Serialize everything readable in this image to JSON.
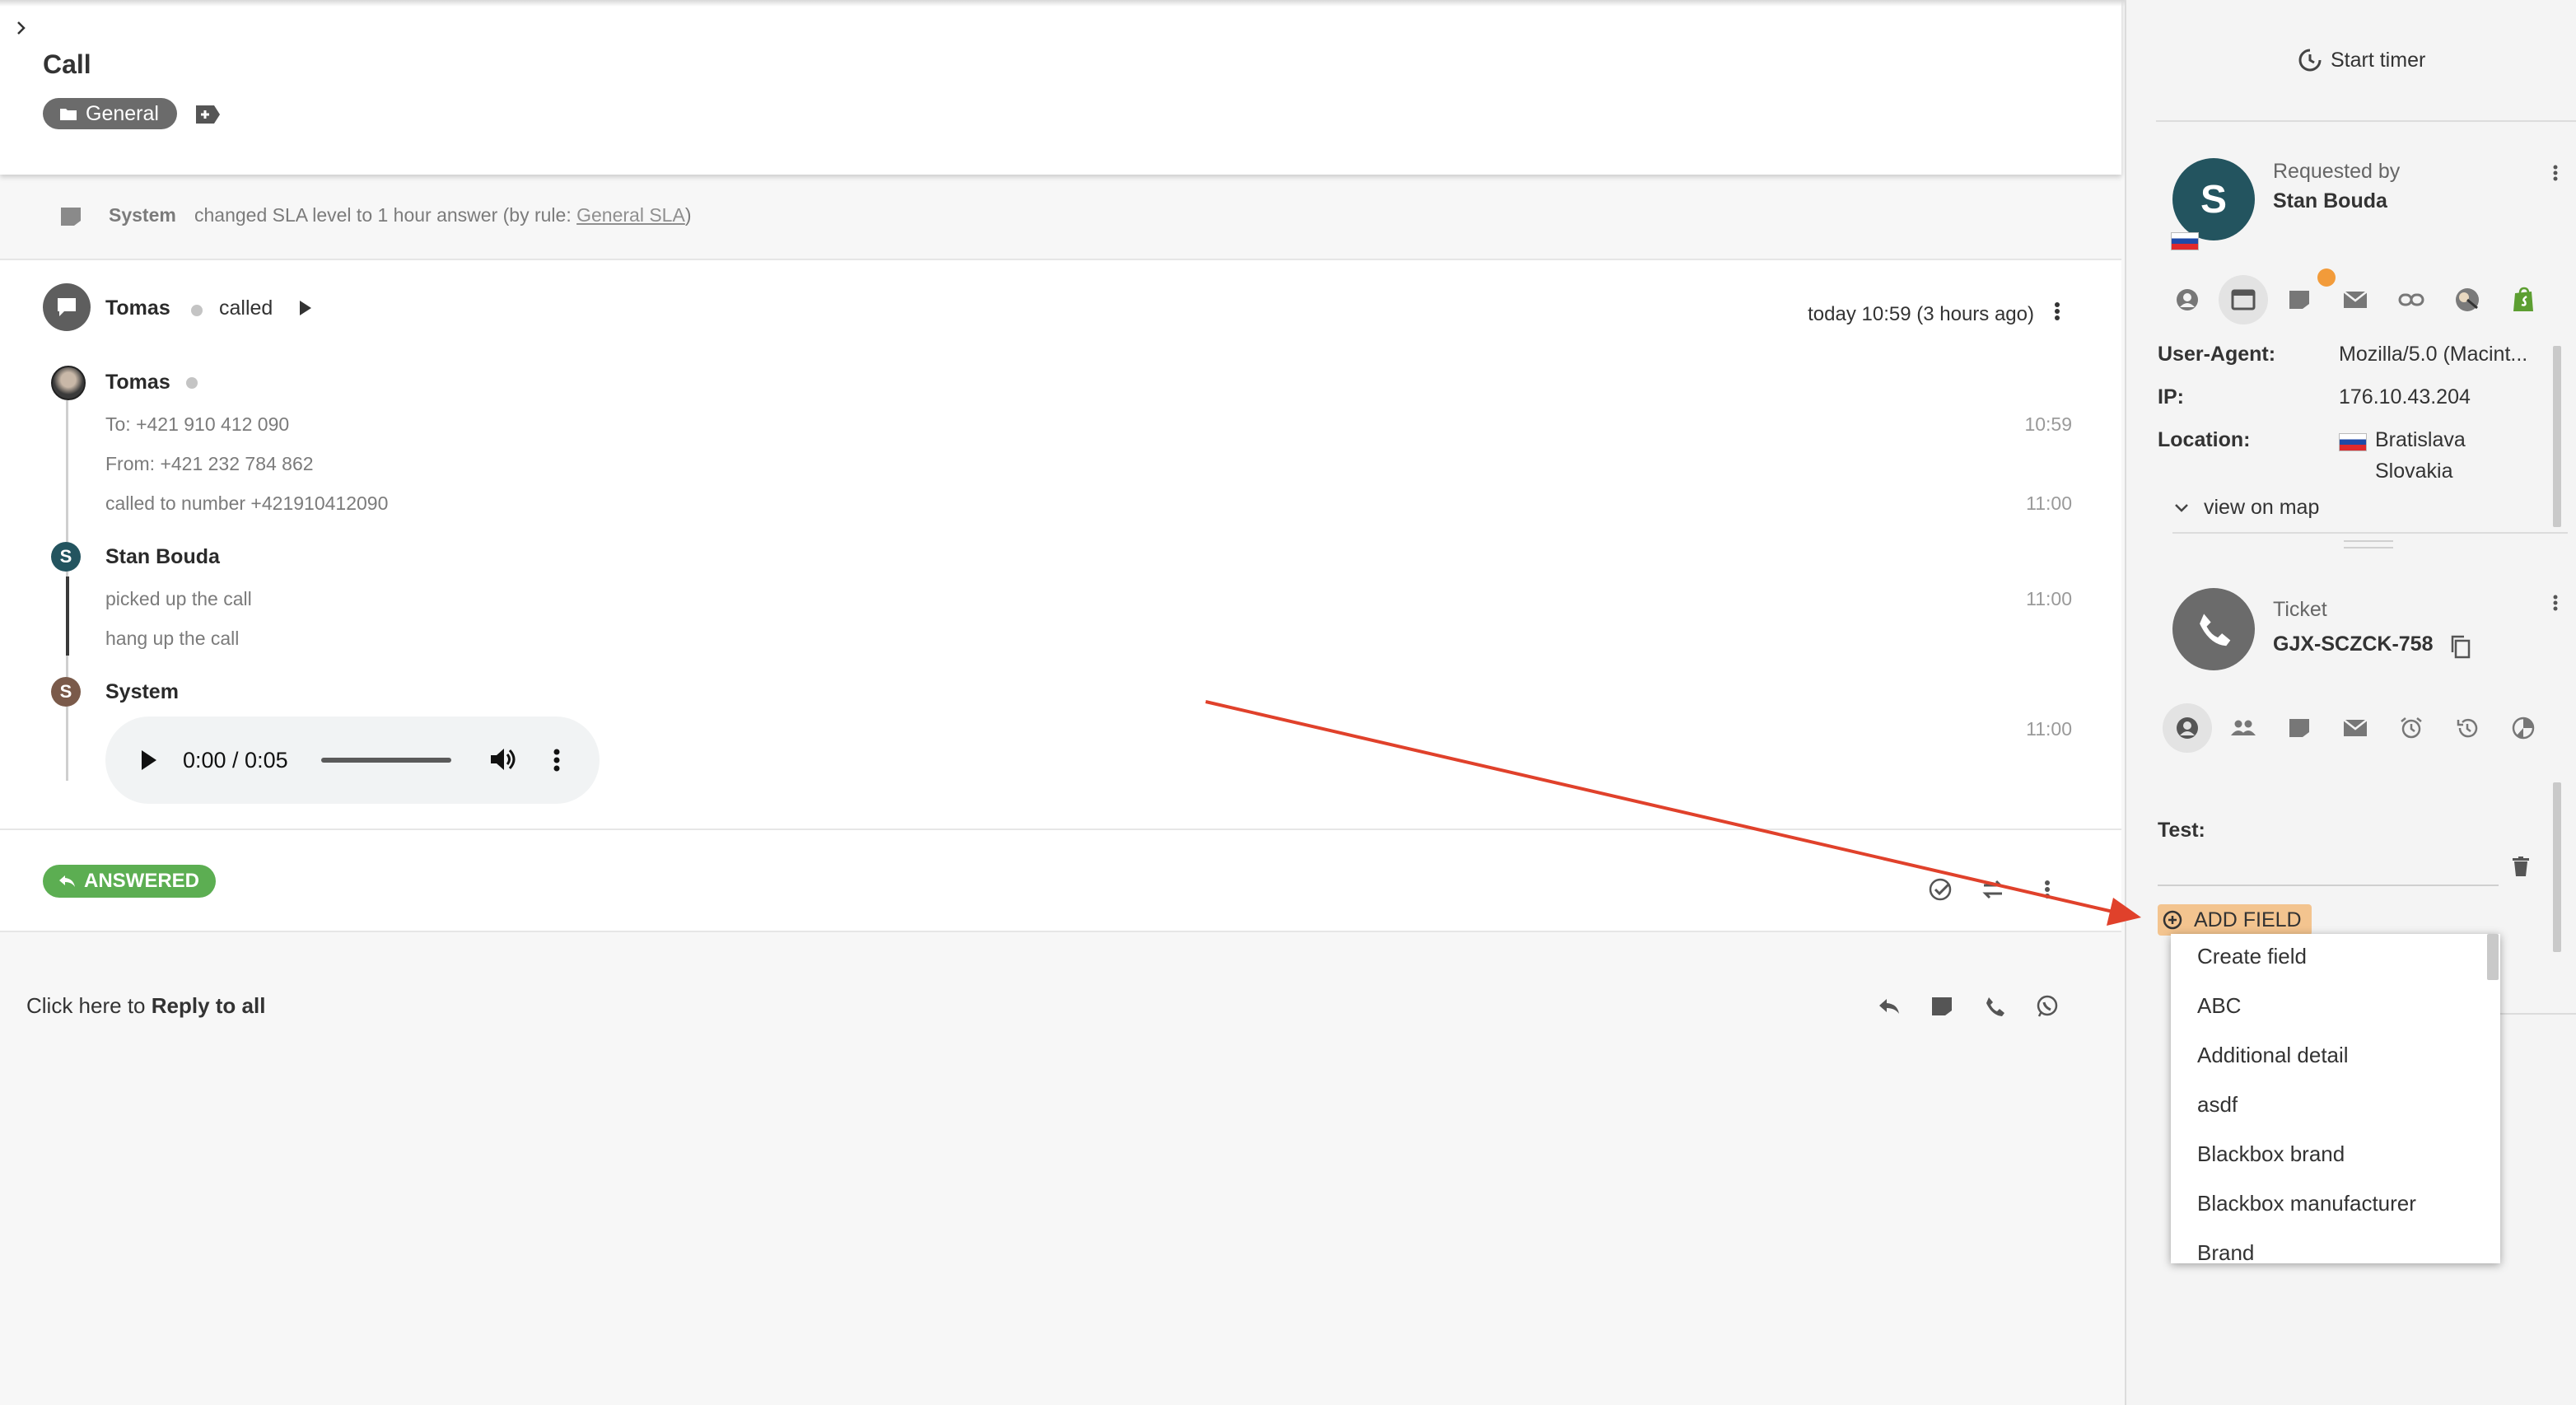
{
  "header": {
    "title": "Call",
    "department_chip": "General",
    "expand_icon": "chevron-right-icon",
    "add_tag_icon": "add-tag-icon"
  },
  "system_event": {
    "actor": "System",
    "text": "changed SLA level to 1 hour answer (by rule: ",
    "rule_link": "General SLA",
    "text_end": ")"
  },
  "thread": {
    "author": "Tomas",
    "action": "called",
    "timestamp": "today 10:59 (3 hours ago)",
    "entries": [
      {
        "name": "Tomas",
        "lines": [
          {
            "text": "To:  +421 910 412 090",
            "time": "10:59"
          },
          {
            "text": "From:  +421 232 784 862",
            "time": ""
          },
          {
            "text": "called to number +421910412090",
            "time": "11:00"
          }
        ]
      },
      {
        "name": "Stan Bouda",
        "avatar_letter": "S",
        "lines": [
          {
            "text": "picked up the call",
            "time": "11:00"
          },
          {
            "text": "hang up the call",
            "time": ""
          }
        ]
      },
      {
        "name": "System",
        "avatar_letter": "S",
        "time": "11:00",
        "audio_time": "0:00 / 0:05"
      }
    ]
  },
  "status": {
    "badge": "ANSWERED"
  },
  "reply": {
    "prefix": "Click here to ",
    "bold": "Reply to all"
  },
  "sidebar": {
    "timer_label": "Start timer",
    "requester": {
      "avatar_letter": "S",
      "caption": "Requested by",
      "name": "Stan Bouda"
    },
    "contact_tools": [
      "user-icon",
      "browser-icon",
      "note-icon",
      "mail-icon",
      "link-icon",
      "logo-icon",
      "shopify-icon"
    ],
    "details": {
      "user_agent_label": "User-Agent:",
      "user_agent_value": "Mozilla/5.0 (Macint...",
      "ip_label": "IP:",
      "ip_value": "176.10.43.204",
      "location_label": "Location:",
      "location_city": "Bratislava",
      "location_country": "Slovakia",
      "map_link": "view on map"
    },
    "ticket": {
      "caption": "Ticket",
      "code": "GJX-SCZCK-758"
    },
    "ticket_tools": [
      "user-icon",
      "group-icon",
      "note-icon",
      "mail-icon",
      "alarm-icon",
      "history-icon",
      "chart-icon"
    ],
    "field_label": "Test:",
    "add_field_label": "ADD FIELD",
    "dropdown_options": [
      "Create field",
      "ABC",
      "Additional detail",
      "asdf",
      "Blackbox brand",
      "Blackbox manufacturer",
      "Brand"
    ]
  },
  "colors": {
    "accent_green": "#5cae52",
    "annotation_arrow": "#e0412b",
    "add_field_highlight": "#f3c48f",
    "avatar_teal": "#23545f",
    "avatar_brown": "#7a5a4a"
  }
}
